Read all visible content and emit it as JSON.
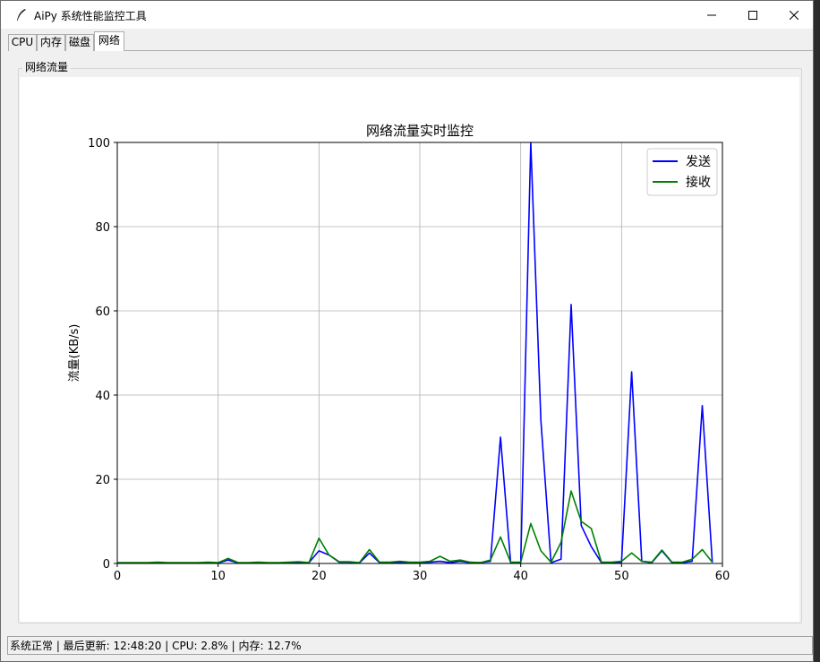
{
  "window": {
    "title": "AiPy 系统性能监控工具",
    "controls": {
      "minimize": "minimize-icon",
      "maximize": "maximize-icon",
      "close": "close-icon"
    }
  },
  "tabs": [
    {
      "label": "CPU",
      "active": false
    },
    {
      "label": "内存",
      "active": false
    },
    {
      "label": "磁盘",
      "active": false
    },
    {
      "label": "网络",
      "active": true
    }
  ],
  "panel": {
    "label": "网络流量"
  },
  "status": {
    "text": "系统正常 | 最后更新: 12:48:20 | CPU: 2.8% | 内存: 12.7%"
  },
  "colors": {
    "send": "#0000ff",
    "receive": "#008000",
    "grid": "#b0b0b0"
  },
  "chart_data": {
    "type": "line",
    "title": "网络流量实时监控",
    "xlabel": "",
    "ylabel": "流量(KB/s)",
    "xlim": [
      0,
      60
    ],
    "ylim": [
      0,
      100
    ],
    "xticks": [
      0,
      10,
      20,
      30,
      40,
      50,
      60
    ],
    "yticks": [
      0,
      20,
      40,
      60,
      80,
      100
    ],
    "grid": true,
    "legend": "top-right",
    "x": [
      0,
      1,
      2,
      3,
      4,
      5,
      6,
      7,
      8,
      9,
      10,
      11,
      12,
      13,
      14,
      15,
      16,
      17,
      18,
      19,
      20,
      21,
      22,
      23,
      24,
      25,
      26,
      27,
      28,
      29,
      30,
      31,
      32,
      33,
      34,
      35,
      36,
      37,
      38,
      39,
      40,
      41,
      42,
      43,
      44,
      45,
      46,
      47,
      48,
      49,
      50,
      51,
      52,
      53,
      54,
      55,
      56,
      57,
      58,
      59
    ],
    "series": [
      {
        "name": "发送",
        "color": "#0000ff",
        "values": [
          0.1,
          0.1,
          0.1,
          0.1,
          0.2,
          0.1,
          0.1,
          0.1,
          0.1,
          0.2,
          0.1,
          0.8,
          0.1,
          0.1,
          0.2,
          0.1,
          0.1,
          0.2,
          0.2,
          0.2,
          3.0,
          2.0,
          0.3,
          0.3,
          0.1,
          2.5,
          0.2,
          0.2,
          0.3,
          0.2,
          0.2,
          0.3,
          0.5,
          0.2,
          0.5,
          0.2,
          0.2,
          0.5,
          30.0,
          0.2,
          0.2,
          100.0,
          34.0,
          0.2,
          1.0,
          61.5,
          9.0,
          4.0,
          0.2,
          0.2,
          0.3,
          45.5,
          0.5,
          0.2,
          3.0,
          0.2,
          0.2,
          0.5,
          37.5,
          0.2
        ]
      },
      {
        "name": "接收",
        "color": "#008000",
        "values": [
          0.2,
          0.2,
          0.2,
          0.2,
          0.3,
          0.2,
          0.2,
          0.2,
          0.2,
          0.3,
          0.2,
          1.2,
          0.2,
          0.2,
          0.3,
          0.2,
          0.2,
          0.3,
          0.4,
          0.2,
          6.0,
          2.0,
          0.4,
          0.4,
          0.2,
          3.3,
          0.3,
          0.3,
          0.5,
          0.3,
          0.3,
          0.5,
          1.7,
          0.5,
          0.8,
          0.3,
          0.2,
          0.8,
          6.3,
          0.3,
          0.3,
          9.5,
          3.0,
          0.3,
          5.0,
          17.2,
          10.0,
          8.3,
          0.3,
          0.3,
          0.5,
          2.5,
          0.5,
          0.3,
          3.2,
          0.3,
          0.3,
          1.0,
          3.3,
          0.3
        ]
      }
    ]
  }
}
